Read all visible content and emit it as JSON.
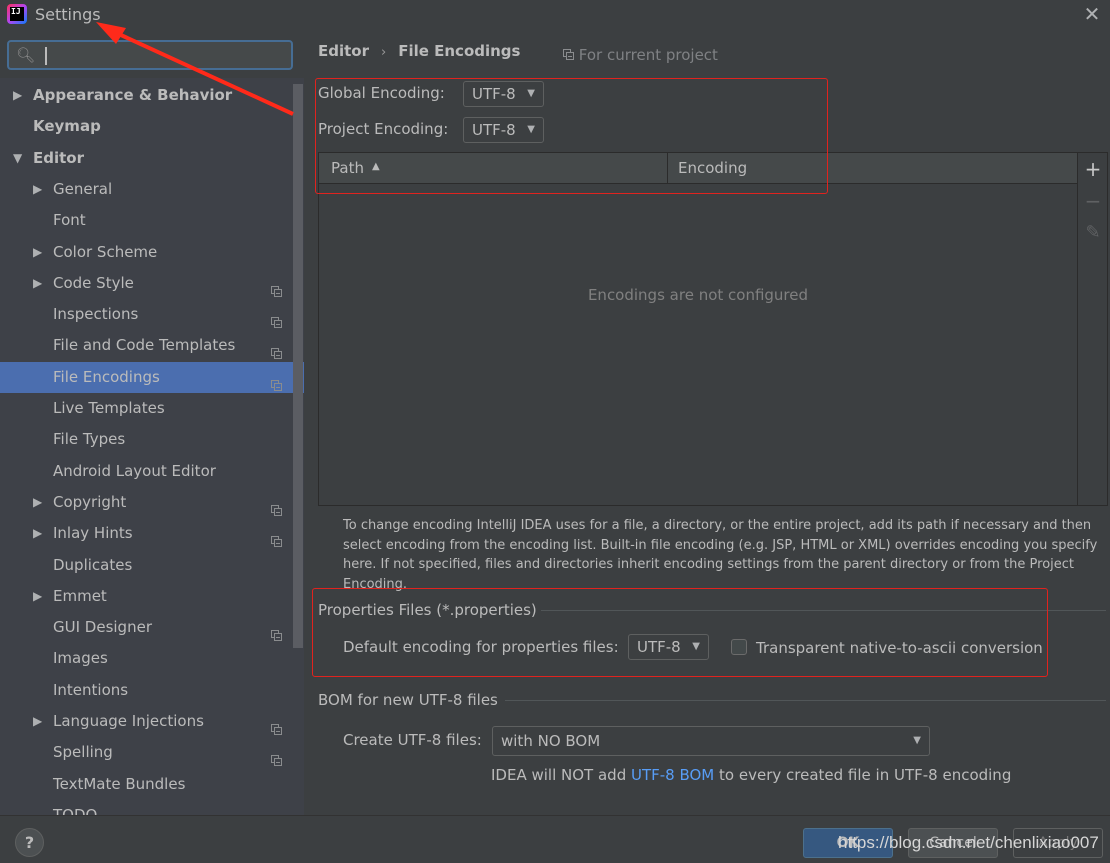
{
  "window": {
    "title": "Settings",
    "close_icon": "✕"
  },
  "search": {
    "placeholder": "",
    "value": ""
  },
  "sidebar": {
    "items": [
      {
        "label": "Appearance & Behavior",
        "level": 0,
        "expandable": true,
        "expanded": false,
        "bold": true,
        "project_icon": false
      },
      {
        "label": "Keymap",
        "level": 0,
        "expandable": false,
        "bold": true,
        "project_icon": false
      },
      {
        "label": "Editor",
        "level": 0,
        "expandable": true,
        "expanded": true,
        "bold": true,
        "project_icon": false
      },
      {
        "label": "General",
        "level": 1,
        "expandable": true,
        "expanded": false,
        "project_icon": false
      },
      {
        "label": "Font",
        "level": 1,
        "expandable": false,
        "project_icon": false
      },
      {
        "label": "Color Scheme",
        "level": 1,
        "expandable": true,
        "expanded": false,
        "project_icon": false
      },
      {
        "label": "Code Style",
        "level": 1,
        "expandable": true,
        "expanded": false,
        "project_icon": true
      },
      {
        "label": "Inspections",
        "level": 1,
        "expandable": false,
        "project_icon": true
      },
      {
        "label": "File and Code Templates",
        "level": 1,
        "expandable": false,
        "project_icon": true
      },
      {
        "label": "File Encodings",
        "level": 1,
        "expandable": false,
        "project_icon": true,
        "selected": true
      },
      {
        "label": "Live Templates",
        "level": 1,
        "expandable": false,
        "project_icon": false
      },
      {
        "label": "File Types",
        "level": 1,
        "expandable": false,
        "project_icon": false
      },
      {
        "label": "Android Layout Editor",
        "level": 1,
        "expandable": false,
        "project_icon": false
      },
      {
        "label": "Copyright",
        "level": 1,
        "expandable": true,
        "expanded": false,
        "project_icon": true
      },
      {
        "label": "Inlay Hints",
        "level": 1,
        "expandable": true,
        "expanded": false,
        "project_icon": true
      },
      {
        "label": "Duplicates",
        "level": 1,
        "expandable": false,
        "project_icon": false
      },
      {
        "label": "Emmet",
        "level": 1,
        "expandable": true,
        "expanded": false,
        "project_icon": false
      },
      {
        "label": "GUI Designer",
        "level": 1,
        "expandable": false,
        "project_icon": true
      },
      {
        "label": "Images",
        "level": 1,
        "expandable": false,
        "project_icon": false
      },
      {
        "label": "Intentions",
        "level": 1,
        "expandable": false,
        "project_icon": false
      },
      {
        "label": "Language Injections",
        "level": 1,
        "expandable": true,
        "expanded": false,
        "project_icon": true
      },
      {
        "label": "Spelling",
        "level": 1,
        "expandable": false,
        "project_icon": true
      },
      {
        "label": "TextMate Bundles",
        "level": 1,
        "expandable": false,
        "project_icon": false
      },
      {
        "label": "TODO",
        "level": 1,
        "expandable": false,
        "project_icon": false
      }
    ]
  },
  "breadcrumb": {
    "parent": "Editor",
    "separator": "›",
    "current": "File Encodings",
    "scope_note": "For current project"
  },
  "encodings": {
    "global_label": "Global Encoding:",
    "global_value": "UTF-8",
    "project_label": "Project Encoding:",
    "project_value": "UTF-8"
  },
  "table": {
    "columns": [
      "Path",
      "Encoding"
    ],
    "sort_column": "Path",
    "sort_direction": "ascending",
    "rows": [],
    "empty_text": "Encodings are not configured",
    "tools": {
      "add": "+",
      "remove": "−",
      "edit": "✎"
    }
  },
  "help_text": "To change encoding IntelliJ IDEA uses for a file, a directory, or the entire project, add its path if necessary and then select encoding from the encoding list. Built-in file encoding (e.g. JSP, HTML or XML) overrides encoding you specify here. If not specified, files and directories inherit encoding settings from the parent directory or from the Project Encoding.",
  "properties": {
    "group_title": "Properties Files (*.properties)",
    "default_label": "Default encoding for properties files:",
    "default_value": "UTF-8",
    "native_to_ascii_label": "Transparent native-to-ascii conversion",
    "native_to_ascii_checked": false
  },
  "bom": {
    "group_title": "BOM for new UTF-8 files",
    "create_label": "Create UTF-8 files:",
    "create_value": "with NO BOM",
    "note_prefix": "IDEA will NOT add ",
    "note_link": "UTF-8 BOM",
    "note_suffix": " to every created file in UTF-8 encoding"
  },
  "footer": {
    "help": "?",
    "ok": "OK",
    "cancel": "Cancel",
    "apply": "Apply",
    "watermark": "https://blog.csdn.net/chenlixiao007"
  },
  "annotations": {
    "color": "#e0231e"
  }
}
